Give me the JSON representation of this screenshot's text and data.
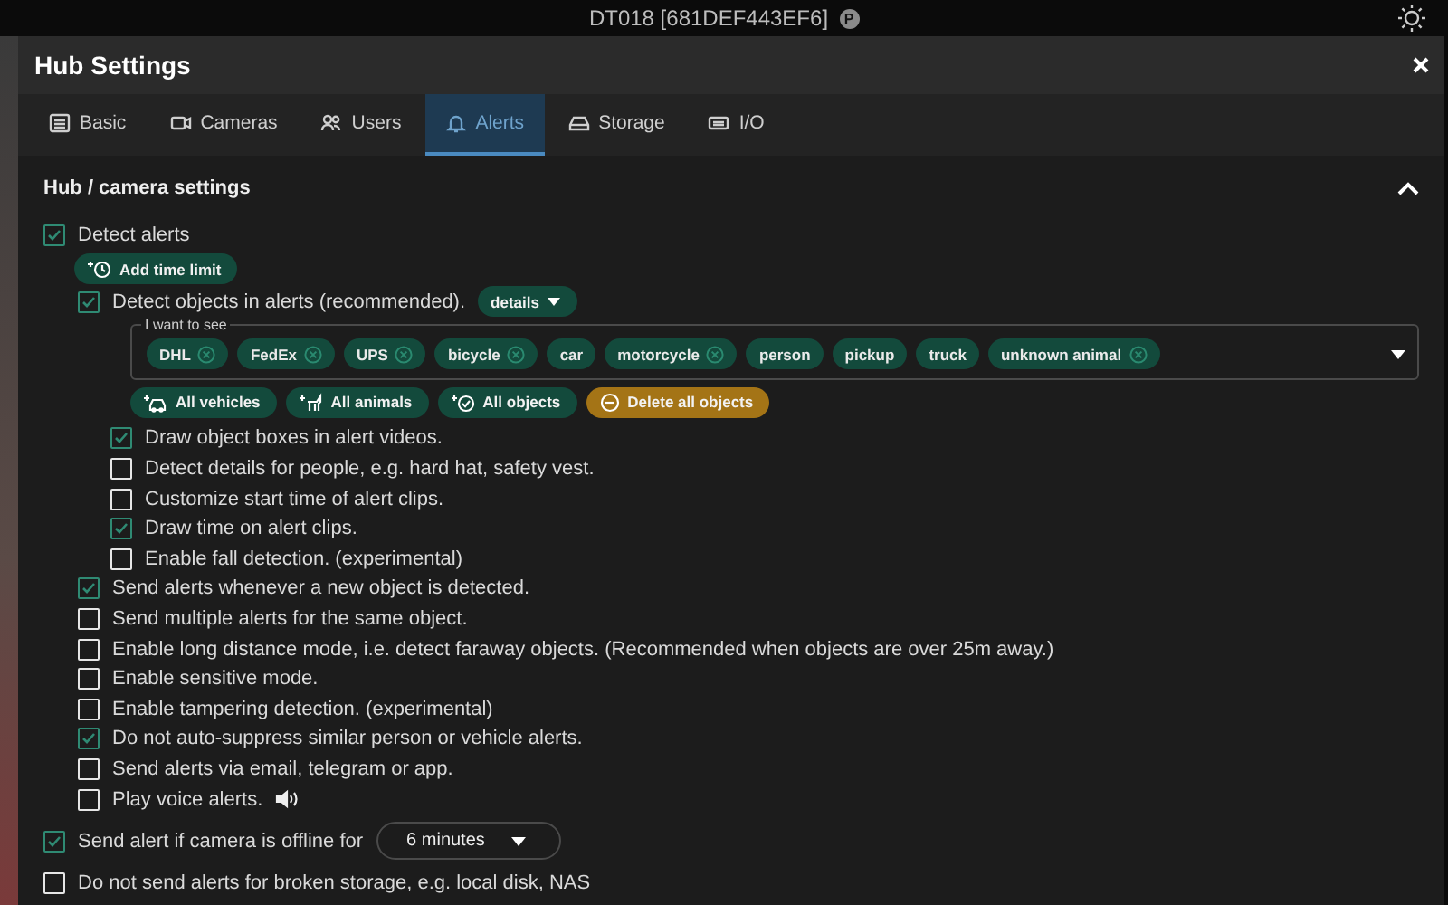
{
  "top_bar": {
    "title": "DT018 [681DEF443EF6]",
    "badge": "P"
  },
  "dialog": {
    "title": "Hub Settings",
    "tabs": [
      {
        "label": "Basic",
        "selected": false
      },
      {
        "label": "Cameras",
        "selected": false
      },
      {
        "label": "Users",
        "selected": false
      },
      {
        "label": "Alerts",
        "selected": true
      },
      {
        "label": "Storage",
        "selected": false
      },
      {
        "label": "I/O",
        "selected": false
      }
    ],
    "section": {
      "title": "Hub / camera settings",
      "expanded": true
    },
    "detect_alerts": {
      "label": "Detect alerts",
      "checked": true,
      "button": "Add time limit"
    },
    "detect_objects": {
      "label": "Detect objects in alerts (recommended).",
      "checked": true,
      "details_button": "details",
      "field": {
        "legend": "I want to see",
        "tags": [
          {
            "label": "DHL",
            "removable": true
          },
          {
            "label": "FedEx",
            "removable": true
          },
          {
            "label": "UPS",
            "removable": true
          },
          {
            "label": "bicycle",
            "removable": true
          },
          {
            "label": "car",
            "removable": false
          },
          {
            "label": "motorcycle",
            "removable": true
          },
          {
            "label": "person",
            "removable": false
          },
          {
            "label": "pickup",
            "removable": false
          },
          {
            "label": "truck",
            "removable": false
          },
          {
            "label": "unknown animal",
            "removable": true
          }
        ]
      },
      "actions": [
        {
          "label": "All vehicles",
          "kind": "vehicles"
        },
        {
          "label": "All animals",
          "kind": "animals"
        },
        {
          "label": "All objects",
          "kind": "objects"
        },
        {
          "label": "Delete all objects",
          "kind": "delete"
        }
      ],
      "options": [
        {
          "label": "Draw object boxes in alert videos.",
          "checked": true
        },
        {
          "label": "Detect details for people, e.g. hard hat, safety vest.",
          "checked": false
        },
        {
          "label": "Customize start time of alert clips.",
          "checked": false
        },
        {
          "label": "Draw time on alert clips.",
          "checked": true
        },
        {
          "label": "Enable fall detection. (experimental)",
          "checked": false
        }
      ]
    },
    "options": [
      {
        "label": "Send alerts whenever a new object is detected.",
        "checked": true,
        "speaker": false
      },
      {
        "label": "Send multiple alerts for the same object.",
        "checked": false,
        "speaker": false
      },
      {
        "label": "Enable long distance mode, i.e. detect faraway objects. (Recommended when objects are over 25m away.)",
        "checked": false,
        "speaker": false
      },
      {
        "label": "Enable sensitive mode.",
        "checked": false,
        "speaker": false
      },
      {
        "label": "Enable tampering detection. (experimental)",
        "checked": false,
        "speaker": false
      },
      {
        "label": "Do not auto-suppress similar person or vehicle alerts.",
        "checked": true,
        "speaker": false
      },
      {
        "label": "Send alerts via email, telegram or app.",
        "checked": false,
        "speaker": false
      },
      {
        "label": "Play voice alerts.",
        "checked": false,
        "speaker": true
      }
    ],
    "offline": {
      "label": "Send alert if camera is offline for",
      "checked": true,
      "select": "6 minutes"
    },
    "storage_option": {
      "label": "Do not send alerts for broken storage, e.g. local disk, NAS",
      "checked": false
    }
  }
}
